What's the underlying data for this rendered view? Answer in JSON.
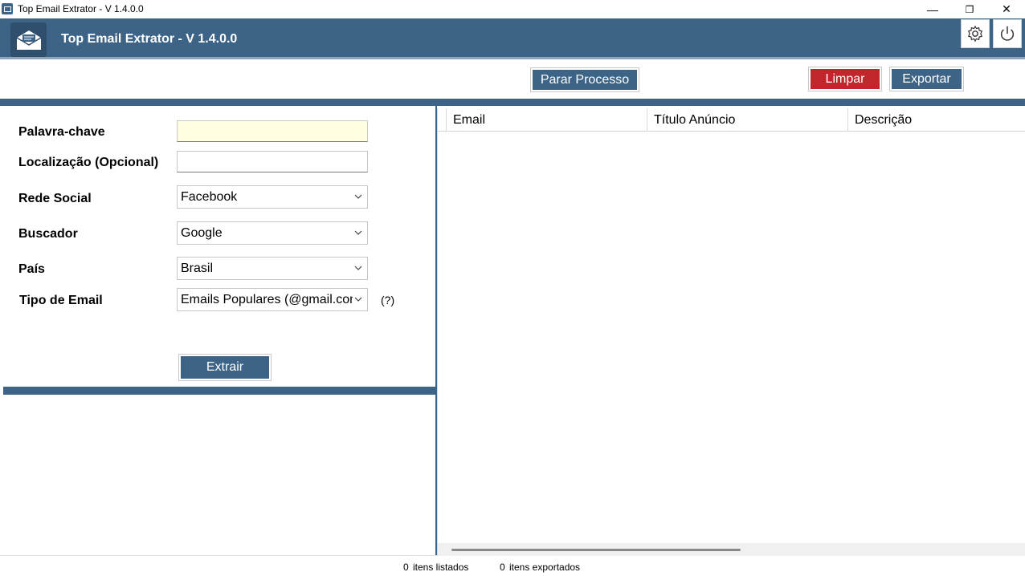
{
  "window": {
    "title": "Top Email Extrator - V 1.4.0.0",
    "minimize_glyph": "—",
    "restore_glyph": "❐",
    "close_glyph": "✕"
  },
  "header": {
    "title": "Top Email Extrator - V 1.4.0.0",
    "logo_icon": "envelope-icon",
    "settings_icon": "gear-icon",
    "power_icon": "power-icon"
  },
  "toolbar": {
    "stop_label": "Parar Processo",
    "clear_label": "Limpar",
    "export_label": "Exportar"
  },
  "form": {
    "keyword_label": "Palavra-chave",
    "keyword_value": "",
    "location_label": "Localização (Opcional)",
    "location_value": "",
    "social_label": "Rede Social",
    "social_value": "Facebook",
    "engine_label": "Buscador",
    "engine_value": "Google",
    "country_label": "País",
    "country_value": "Brasil",
    "email_type_label": "Tipo de Email",
    "email_type_value": "Emails Populares (@gmail.com",
    "help_label": "(?)",
    "extract_label": "Extrair"
  },
  "grid": {
    "columns": [
      "Email",
      "Título Anúncio",
      "Descrição"
    ]
  },
  "status": {
    "listed_count": "0",
    "listed_label": "itens listados",
    "exported_count": "0",
    "exported_label": "itens exportados"
  },
  "colors": {
    "primary": "#3d6487",
    "danger": "#c0262b",
    "keyword_field_bg": "#fffde0"
  }
}
